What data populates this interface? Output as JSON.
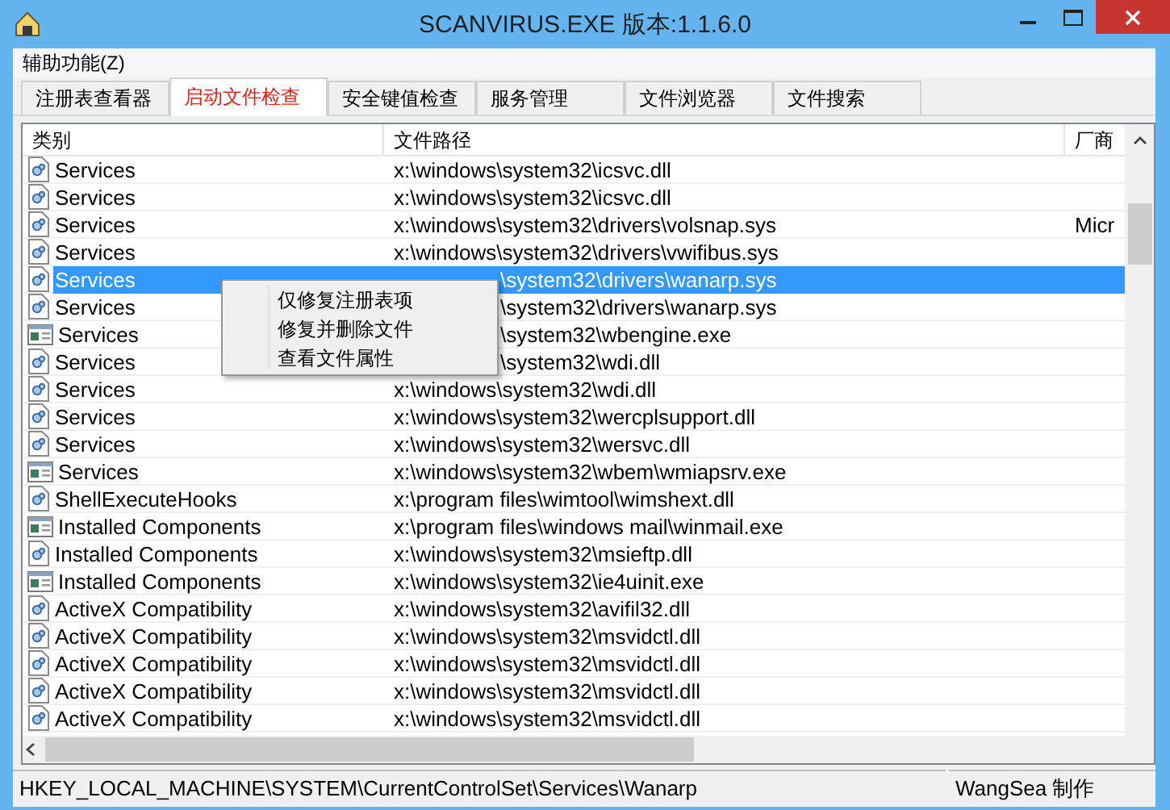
{
  "window": {
    "title": "SCANVIRUS.EXE  版本:1.1.6.0"
  },
  "menu": [
    "辅助功能(Z)"
  ],
  "tabs": [
    {
      "label": "注册表查看器",
      "selected": false
    },
    {
      "label": "启动文件检查",
      "selected": true
    },
    {
      "label": "安全键值检查",
      "selected": false
    },
    {
      "label": "服务管理",
      "selected": false
    },
    {
      "label": "文件浏览器",
      "selected": false
    },
    {
      "label": "文件搜索",
      "selected": false
    }
  ],
  "table": {
    "columns": [
      "类别",
      "文件路径",
      "厂商"
    ],
    "rows": [
      {
        "kind": "library",
        "category": "Services",
        "path": "x:\\windows\\system32\\icsvc.dll",
        "selected": false
      },
      {
        "kind": "library",
        "category": "Services",
        "path": "x:\\windows\\system32\\icsvc.dll",
        "selected": false
      },
      {
        "kind": "library",
        "category": "Services",
        "path": "x:\\windows\\system32\\drivers\\volsnap.sys",
        "vendor": "Micr",
        "selected": false
      },
      {
        "kind": "library",
        "category": "Services",
        "path": "x:\\windows\\system32\\drivers\\vwifibus.sys",
        "selected": false
      },
      {
        "kind": "library",
        "category": "Services",
        "path": "\\system32\\drivers\\wanarp.sys",
        "partly_hidden": true,
        "selected": true
      },
      {
        "kind": "library",
        "category": "Services",
        "path": "\\system32\\drivers\\wanarp.sys",
        "partly_hidden": true,
        "selected": false
      },
      {
        "kind": "program",
        "category": "Services",
        "path": "\\system32\\wbengine.exe",
        "partly_hidden": true,
        "selected": false
      },
      {
        "kind": "library",
        "category": "Services",
        "path": "\\system32\\wdi.dll",
        "partly_hidden": true,
        "selected": false
      },
      {
        "kind": "library",
        "category": "Services",
        "path": "x:\\windows\\system32\\wdi.dll",
        "selected": false
      },
      {
        "kind": "library",
        "category": "Services",
        "path": "x:\\windows\\system32\\wercplsupport.dll",
        "selected": false
      },
      {
        "kind": "library",
        "category": "Services",
        "path": "x:\\windows\\system32\\wersvc.dll",
        "selected": false
      },
      {
        "kind": "program",
        "category": "Services",
        "path": "x:\\windows\\system32\\wbem\\wmiapsrv.exe",
        "selected": false
      },
      {
        "kind": "library",
        "category": "ShellExecuteHooks",
        "path": "x:\\program files\\wimtool\\wimshext.dll",
        "selected": false
      },
      {
        "kind": "program",
        "category": "Installed Components",
        "path": "x:\\program files\\windows mail\\winmail.exe",
        "selected": false
      },
      {
        "kind": "library",
        "category": "Installed Components",
        "path": "x:\\windows\\system32\\msieftp.dll",
        "selected": false
      },
      {
        "kind": "program",
        "category": "Installed Components",
        "path": "x:\\windows\\system32\\ie4uinit.exe",
        "selected": false
      },
      {
        "kind": "library",
        "category": "ActiveX Compatibility",
        "path": "x:\\windows\\system32\\avifil32.dll",
        "selected": false
      },
      {
        "kind": "library",
        "category": "ActiveX Compatibility",
        "path": "x:\\windows\\system32\\msvidctl.dll",
        "selected": false
      },
      {
        "kind": "library",
        "category": "ActiveX Compatibility",
        "path": "x:\\windows\\system32\\msvidctl.dll",
        "selected": false
      },
      {
        "kind": "library",
        "category": "ActiveX Compatibility",
        "path": "x:\\windows\\system32\\msvidctl.dll",
        "selected": false
      },
      {
        "kind": "library",
        "category": "ActiveX Compatibility",
        "path": "x:\\windows\\system32\\msvidctl.dll",
        "selected": false
      }
    ]
  },
  "context_menu": [
    "仅修复注册表项",
    "修复并删除文件",
    "查看文件属性"
  ],
  "status_bar": [
    "HKEY_LOCAL_MACHINE\\SYSTEM\\CurrentControlSet\\Services\\Wanarp",
    "WangSea 制作"
  ]
}
